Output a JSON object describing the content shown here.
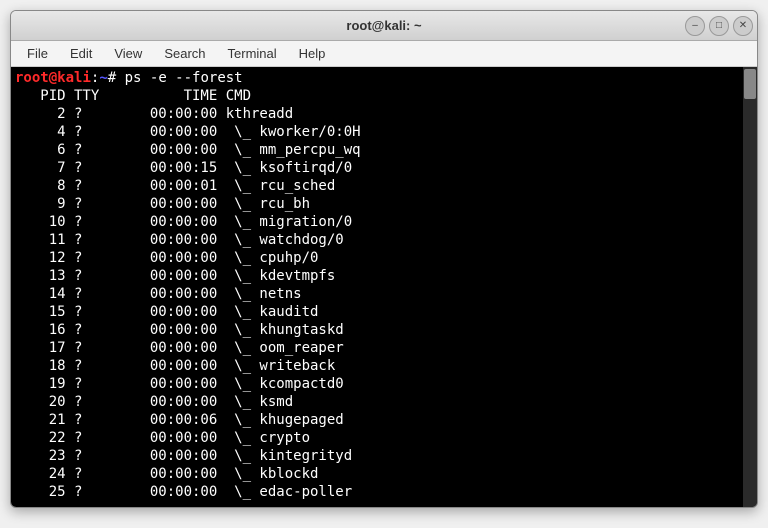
{
  "window": {
    "title": "root@kali: ~"
  },
  "menu": {
    "file": "File",
    "edit": "Edit",
    "view": "View",
    "search": "Search",
    "terminal": "Terminal",
    "help": "Help"
  },
  "prompt": {
    "user": "root",
    "at": "@",
    "host": "kali",
    "colon": ":",
    "path": "~",
    "symbol": "# "
  },
  "command": "ps -e --forest",
  "header": "   PID TTY          TIME CMD",
  "rows": [
    {
      "pid": "     2",
      "tty": "?",
      "time": "00:00:00",
      "tree": "",
      "cmd": "kthreadd"
    },
    {
      "pid": "     4",
      "tty": "?",
      "time": "00:00:00",
      "tree": " \\_ ",
      "cmd": "kworker/0:0H"
    },
    {
      "pid": "     6",
      "tty": "?",
      "time": "00:00:00",
      "tree": " \\_ ",
      "cmd": "mm_percpu_wq"
    },
    {
      "pid": "     7",
      "tty": "?",
      "time": "00:00:15",
      "tree": " \\_ ",
      "cmd": "ksoftirqd/0"
    },
    {
      "pid": "     8",
      "tty": "?",
      "time": "00:00:01",
      "tree": " \\_ ",
      "cmd": "rcu_sched"
    },
    {
      "pid": "     9",
      "tty": "?",
      "time": "00:00:00",
      "tree": " \\_ ",
      "cmd": "rcu_bh"
    },
    {
      "pid": "    10",
      "tty": "?",
      "time": "00:00:00",
      "tree": " \\_ ",
      "cmd": "migration/0"
    },
    {
      "pid": "    11",
      "tty": "?",
      "time": "00:00:00",
      "tree": " \\_ ",
      "cmd": "watchdog/0"
    },
    {
      "pid": "    12",
      "tty": "?",
      "time": "00:00:00",
      "tree": " \\_ ",
      "cmd": "cpuhp/0"
    },
    {
      "pid": "    13",
      "tty": "?",
      "time": "00:00:00",
      "tree": " \\_ ",
      "cmd": "kdevtmpfs"
    },
    {
      "pid": "    14",
      "tty": "?",
      "time": "00:00:00",
      "tree": " \\_ ",
      "cmd": "netns"
    },
    {
      "pid": "    15",
      "tty": "?",
      "time": "00:00:00",
      "tree": " \\_ ",
      "cmd": "kauditd"
    },
    {
      "pid": "    16",
      "tty": "?",
      "time": "00:00:00",
      "tree": " \\_ ",
      "cmd": "khungtaskd"
    },
    {
      "pid": "    17",
      "tty": "?",
      "time": "00:00:00",
      "tree": " \\_ ",
      "cmd": "oom_reaper"
    },
    {
      "pid": "    18",
      "tty": "?",
      "time": "00:00:00",
      "tree": " \\_ ",
      "cmd": "writeback"
    },
    {
      "pid": "    19",
      "tty": "?",
      "time": "00:00:00",
      "tree": " \\_ ",
      "cmd": "kcompactd0"
    },
    {
      "pid": "    20",
      "tty": "?",
      "time": "00:00:00",
      "tree": " \\_ ",
      "cmd": "ksmd"
    },
    {
      "pid": "    21",
      "tty": "?",
      "time": "00:00:06",
      "tree": " \\_ ",
      "cmd": "khugepaged"
    },
    {
      "pid": "    22",
      "tty": "?",
      "time": "00:00:00",
      "tree": " \\_ ",
      "cmd": "crypto"
    },
    {
      "pid": "    23",
      "tty": "?",
      "time": "00:00:00",
      "tree": " \\_ ",
      "cmd": "kintegrityd"
    },
    {
      "pid": "    24",
      "tty": "?",
      "time": "00:00:00",
      "tree": " \\_ ",
      "cmd": "kblockd"
    },
    {
      "pid": "    25",
      "tty": "?",
      "time": "00:00:00",
      "tree": " \\_ ",
      "cmd": "edac-poller"
    }
  ]
}
